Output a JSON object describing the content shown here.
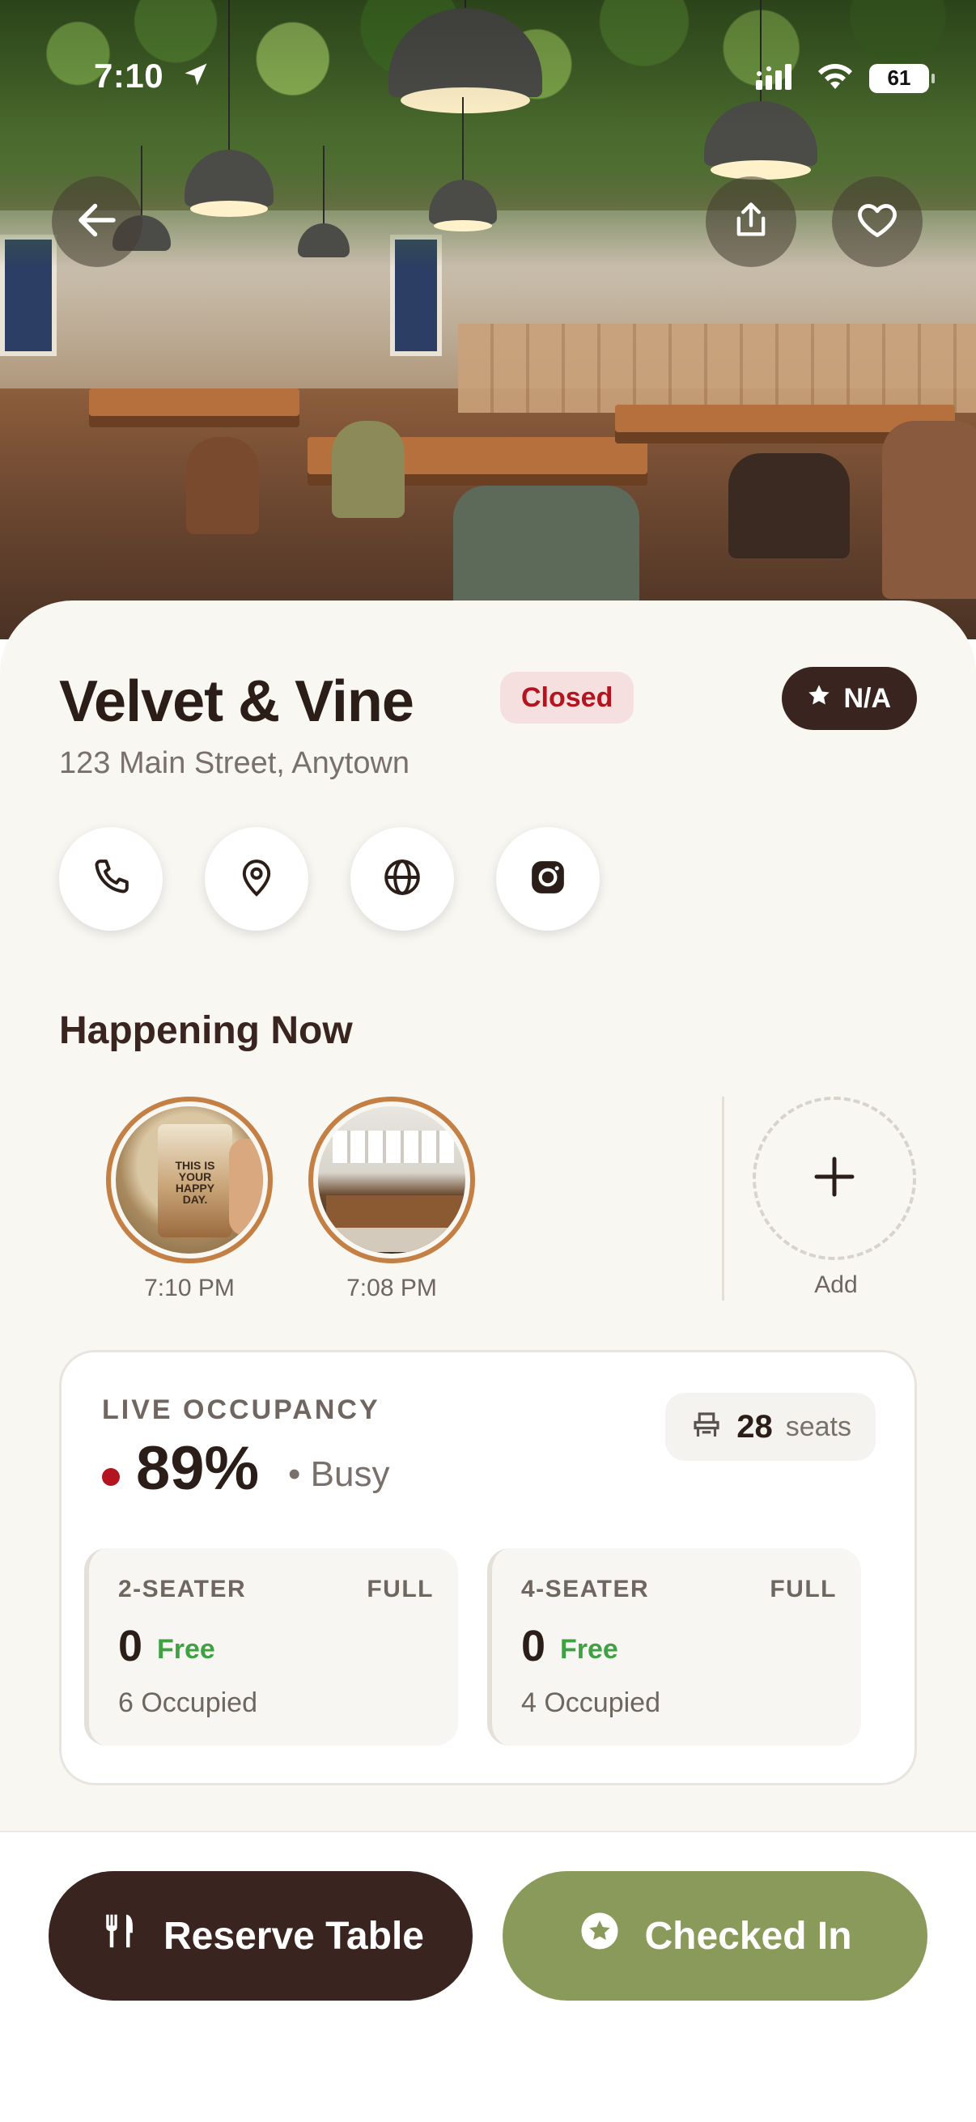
{
  "status_bar": {
    "time": "7:10",
    "battery": "61"
  },
  "venue": {
    "name": "Velvet & Vine",
    "status_badge": "Closed",
    "rating": "N/A",
    "address": "123 Main Street, Anytown"
  },
  "happening_now": {
    "title": "Happening Now",
    "stories": [
      {
        "time": "7:10 PM",
        "caption": "THIS IS YOUR HAPPY DAY."
      },
      {
        "time": "7:08 PM"
      }
    ],
    "add_label": "Add"
  },
  "occupancy": {
    "title": "LIVE OCCUPANCY",
    "percent": "89%",
    "status": "• Busy",
    "seats_count": "28",
    "seats_unit": "seats",
    "tables": [
      {
        "type": "2-SEATER",
        "state": "FULL",
        "free": "0",
        "free_label": "Free",
        "occupied": "6 Occupied"
      },
      {
        "type": "4-SEATER",
        "state": "FULL",
        "free": "0",
        "free_label": "Free",
        "occupied": "4 Occupied"
      }
    ]
  },
  "actions": {
    "reserve": "Reserve Table",
    "checked_in": "Checked In"
  },
  "colors": {
    "brand_dark": "#3a2420",
    "brand_green": "#8a9a5b",
    "closed_red": "#b3141f",
    "free_green": "#3fa143",
    "story_ring": "#c47f45"
  },
  "icons": [
    "back-arrow-icon",
    "share-icon",
    "heart-icon",
    "star-icon",
    "phone-icon",
    "map-pin-icon",
    "globe-icon",
    "instagram-icon",
    "plus-icon",
    "seat-icon",
    "fork-knife-icon",
    "star-badge-icon",
    "location-arrow-icon",
    "signal-icon",
    "wifi-icon"
  ]
}
